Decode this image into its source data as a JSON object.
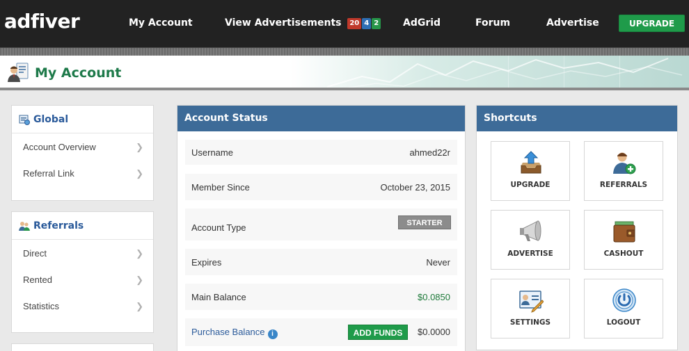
{
  "brand": {
    "logo": "adfiver"
  },
  "nav": {
    "items": [
      {
        "label": "My Account"
      },
      {
        "label": "View Advertisements"
      },
      {
        "label": "AdGrid"
      },
      {
        "label": "Forum"
      },
      {
        "label": "Advertise"
      }
    ],
    "badges": [
      {
        "value": "20",
        "color": "#c0392b"
      },
      {
        "value": "4",
        "color": "#2e6fb5"
      },
      {
        "value": "2",
        "color": "#27964a"
      }
    ],
    "upgrade_label": "UPGRADE"
  },
  "page": {
    "title": "My Account"
  },
  "sidebar": {
    "global": {
      "title": "Global",
      "items": [
        {
          "label": "Account Overview"
        },
        {
          "label": "Referral Link"
        }
      ]
    },
    "referrals": {
      "title": "Referrals",
      "items": [
        {
          "label": "Direct"
        },
        {
          "label": "Rented"
        },
        {
          "label": "Statistics"
        }
      ]
    }
  },
  "account_status": {
    "title": "Account Status",
    "rows": [
      {
        "key": "Username",
        "value": "ahmed22r"
      },
      {
        "key": "Member Since",
        "value": "October 23, 2015"
      },
      {
        "key": "Account Type",
        "value": "STARTER"
      },
      {
        "key": "Expires",
        "value": "Never"
      },
      {
        "key": "Main Balance",
        "value": "$0.0850"
      },
      {
        "key": "Purchase Balance",
        "value": "$0.0000"
      }
    ],
    "add_funds_label": "ADD FUNDS"
  },
  "shortcuts": {
    "title": "Shortcuts",
    "tiles": [
      {
        "label": "UPGRADE",
        "icon": "upload-tray-icon"
      },
      {
        "label": "REFERRALS",
        "icon": "add-user-icon"
      },
      {
        "label": "ADVERTISE",
        "icon": "megaphone-icon"
      },
      {
        "label": "CASHOUT",
        "icon": "wallet-icon"
      },
      {
        "label": "SETTINGS",
        "icon": "settings-card-icon"
      },
      {
        "label": "LOGOUT",
        "icon": "power-icon"
      }
    ]
  }
}
